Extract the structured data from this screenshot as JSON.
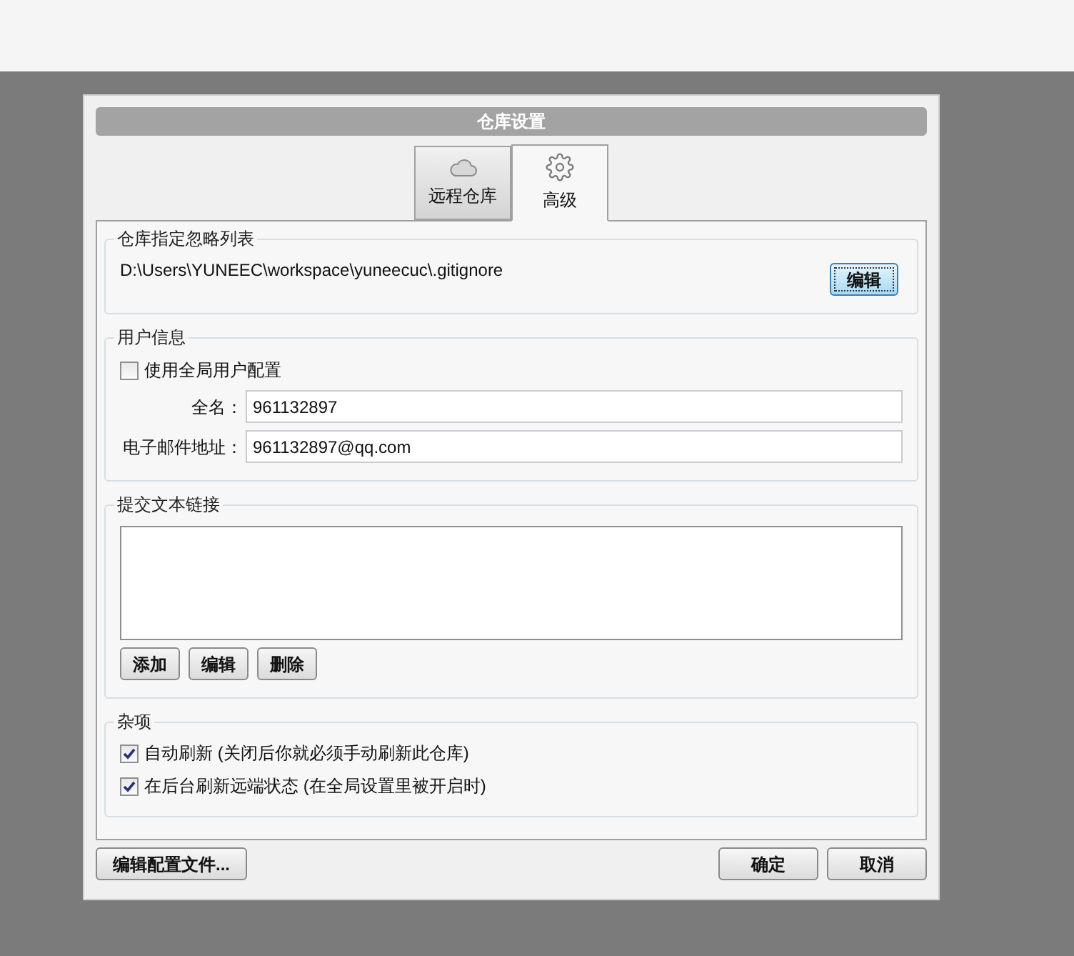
{
  "dialog": {
    "title": "仓库设置"
  },
  "tabs": [
    {
      "label": "远程仓库",
      "kind": "cloud",
      "selected": false
    },
    {
      "label": "高级",
      "kind": "gear",
      "selected": true
    }
  ],
  "ignore_list": {
    "heading": "仓库指定忽略列表",
    "path": "D:\\Users\\YUNEEC\\workspace\\yuneecuc\\.gitignore",
    "edit_button": "编辑"
  },
  "user_info": {
    "heading": "用户信息",
    "use_global": {
      "label": "使用全局用户配置",
      "checked": false
    },
    "fields": [
      {
        "label": "全名：",
        "value": "961132897"
      },
      {
        "label": "电子邮件地址：",
        "value": "961132897@qq.com"
      }
    ]
  },
  "commit_links": {
    "heading": "提交文本链接",
    "buttons": [
      "添加",
      "编辑",
      "删除"
    ]
  },
  "misc": {
    "heading": "杂项",
    "options": [
      {
        "label": "自动刷新 (关闭后你就必须手动刷新此仓库)",
        "checked": true
      },
      {
        "label": "在后台刷新远端状态 (在全局设置里被开启时)",
        "checked": true
      }
    ]
  },
  "footer": {
    "left_button": "编辑配置文件...",
    "right_buttons": [
      "确定",
      "取消"
    ]
  }
}
